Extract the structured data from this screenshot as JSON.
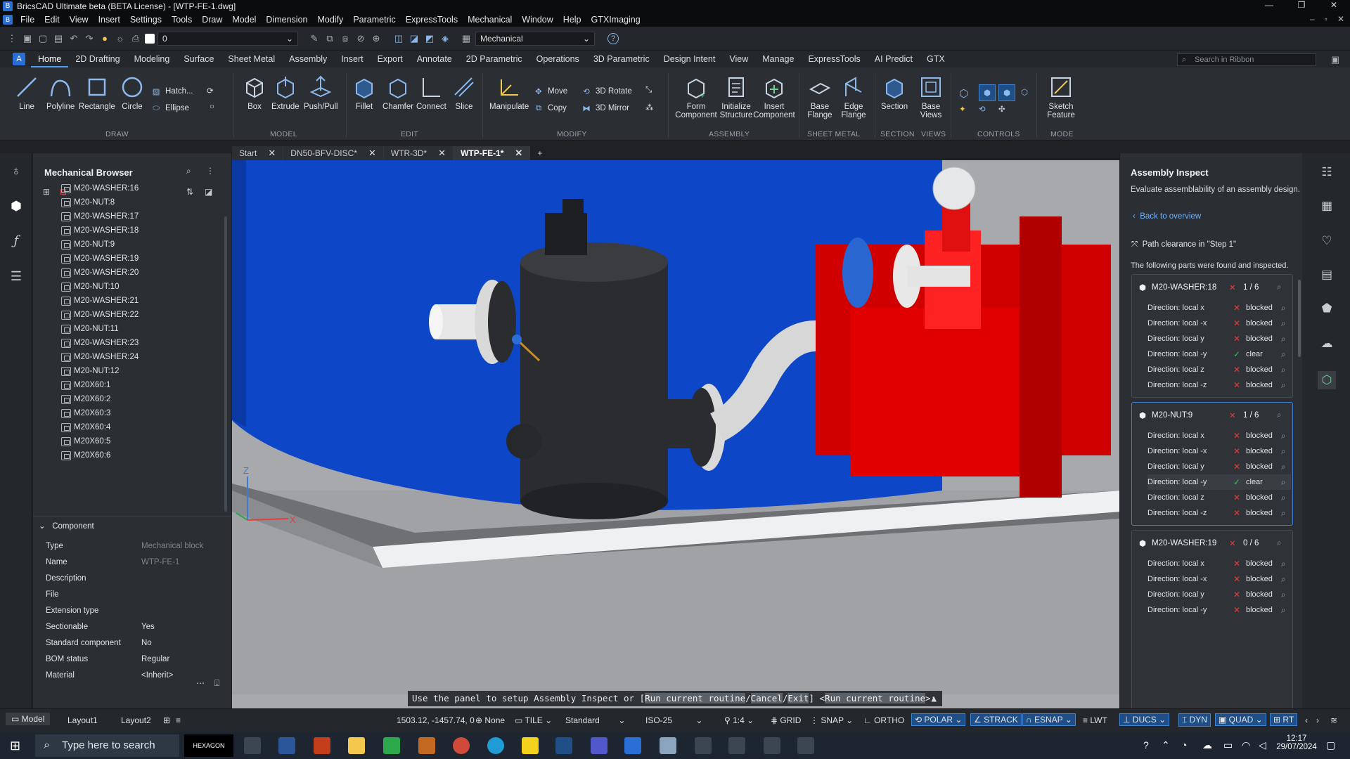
{
  "title_bar": {
    "title": "BricsCAD Ultimate beta (BETA License) - [WTP-FE-1.dwg]"
  },
  "menu": [
    "File",
    "Edit",
    "View",
    "Insert",
    "Settings",
    "Tools",
    "Draw",
    "Model",
    "Dimension",
    "Modify",
    "Parametric",
    "ExpressTools",
    "Mechanical",
    "Window",
    "Help",
    "GTXImaging"
  ],
  "qat": {
    "layer_value": "0",
    "workspace": "Mechanical"
  },
  "ribbon_tabs": [
    "Home",
    "2D Drafting",
    "Modeling",
    "Surface",
    "Sheet Metal",
    "Assembly",
    "Insert",
    "Export",
    "Annotate",
    "2D Parametric",
    "Operations",
    "3D Parametric",
    "Design Intent",
    "View",
    "Manage",
    "ExpressTools",
    "AI Predict",
    "GTX"
  ],
  "ribbon_search": "Search in Ribbon",
  "ribbon": {
    "line": "Line",
    "polyline": "Polyline",
    "rectangle": "Rectangle",
    "circle": "Circle",
    "hatch": "Hatch...",
    "ellipse": "Ellipse",
    "box": "Box",
    "extrude": "Extrude",
    "pushpull": "Push/Pull",
    "fillet": "Fillet",
    "chamfer": "Chamfer",
    "connect": "Connect",
    "slice": "Slice",
    "manipulate": "Manipulate",
    "move": "Move",
    "copy": "Copy",
    "rotate3d": "3D Rotate",
    "mirror3d": "3D Mirror",
    "form_component": "Form Component",
    "initialize_structure": "Initialize Structure",
    "insert_component": "Insert Component",
    "base_flange": "Base Flange",
    "edge_flange": "Edge Flange",
    "section": "Section",
    "base_views": "Base Views",
    "sketch_feature": "Sketch Feature",
    "groups": {
      "draw": "DRAW",
      "model": "MODEL",
      "edit": "EDIT",
      "modify": "MODIFY",
      "assembly": "ASSEMBLY",
      "sheet_metal": "SHEET METAL",
      "section": "SECTION",
      "views": "VIEWS",
      "controls": "CONTROLS",
      "mode": "MODE"
    }
  },
  "browser": {
    "title": "Mechanical Browser",
    "items": [
      "M20-WASHER:16",
      "M20-NUT:8",
      "M20-WASHER:17",
      "M20-WASHER:18",
      "M20-NUT:9",
      "M20-WASHER:19",
      "M20-WASHER:20",
      "M20-NUT:10",
      "M20-WASHER:21",
      "M20-WASHER:22",
      "M20-NUT:11",
      "M20-WASHER:23",
      "M20-WASHER:24",
      "M20-NUT:12",
      "M20X60:1",
      "M20X60:2",
      "M20X60:3",
      "M20X60:4",
      "M20X60:5",
      "M20X60:6"
    ],
    "props_header": "Component",
    "props": [
      {
        "k": "Type",
        "v": "Mechanical block"
      },
      {
        "k": "Name",
        "v": "WTP-FE-1"
      },
      {
        "k": "Description",
        "v": ""
      },
      {
        "k": "File",
        "v": ""
      },
      {
        "k": "Extension type",
        "v": ""
      },
      {
        "k": "Sectionable",
        "v": "Yes"
      },
      {
        "k": "Standard component",
        "v": "No"
      },
      {
        "k": "BOM status",
        "v": "Regular"
      },
      {
        "k": "Material",
        "v": "<Inherit>"
      }
    ]
  },
  "doc_tabs": [
    "Start",
    "DN50-BFV-DISC*",
    "WTR-3D*",
    "WTP-FE-1*"
  ],
  "command": {
    "prefix": "Use the panel to setup Assembly Inspect or [",
    "opt1": "Run current routine",
    "opt2": "Cancel",
    "opt3": "Exit",
    "mid": "] <",
    "default": "Run current routine",
    "suffix": ">:"
  },
  "inspect": {
    "title": "Assembly Inspect",
    "subtitle": "Evaluate assemblability of an assembly design.",
    "back": "Back to overview",
    "path": "Path clearance in \"Step 1\"",
    "found": "The following parts were found and inspected.",
    "cards": [
      {
        "name": "M20-WASHER:18",
        "count": "1 / 6",
        "rows": [
          {
            "d": "Direction: local x",
            "s": "blocked"
          },
          {
            "d": "Direction: local -x",
            "s": "blocked"
          },
          {
            "d": "Direction: local y",
            "s": "blocked"
          },
          {
            "d": "Direction: local -y",
            "s": "clear"
          },
          {
            "d": "Direction: local z",
            "s": "blocked"
          },
          {
            "d": "Direction: local -z",
            "s": "blocked"
          }
        ]
      },
      {
        "name": "M20-NUT:9",
        "count": "1 / 6",
        "rows": [
          {
            "d": "Direction: local x",
            "s": "blocked"
          },
          {
            "d": "Direction: local -x",
            "s": "blocked"
          },
          {
            "d": "Direction: local y",
            "s": "blocked"
          },
          {
            "d": "Direction: local -y",
            "s": "clear"
          },
          {
            "d": "Direction: local z",
            "s": "blocked"
          },
          {
            "d": "Direction: local -z",
            "s": "blocked"
          }
        ]
      },
      {
        "name": "M20-WASHER:19",
        "count": "0 / 6",
        "rows": [
          {
            "d": "Direction: local x",
            "s": "blocked"
          },
          {
            "d": "Direction: local -x",
            "s": "blocked"
          },
          {
            "d": "Direction: local y",
            "s": "blocked"
          },
          {
            "d": "Direction: local -y",
            "s": "blocked"
          }
        ]
      }
    ]
  },
  "status": {
    "tabs": [
      "Model",
      "Layout1",
      "Layout2"
    ],
    "coords": "1503.12, -1457.74, 0",
    "none": "None",
    "tile": "TILE",
    "standard": "Standard",
    "iso": "ISO-25",
    "scale": "1:4",
    "grid": "GRID",
    "snap": "SNAP",
    "ortho": "ORTHO",
    "polar": "POLAR",
    "strack": "STRACK",
    "esnap": "ESNAP",
    "lwt": "LWT",
    "ducs": "DUCS",
    "dyn": "DYN",
    "quad": "QUAD",
    "rt": "RT"
  },
  "taskbar": {
    "search": "Type here to search",
    "time": "12:17",
    "date": "29/07/2024",
    "app_label": "HEXAGON"
  },
  "colors": {
    "accent": "#4a9cf5",
    "blocked": "#e0403a",
    "clear": "#3fbf5a",
    "tank": "#0d47c8",
    "pump": "#e00000"
  }
}
